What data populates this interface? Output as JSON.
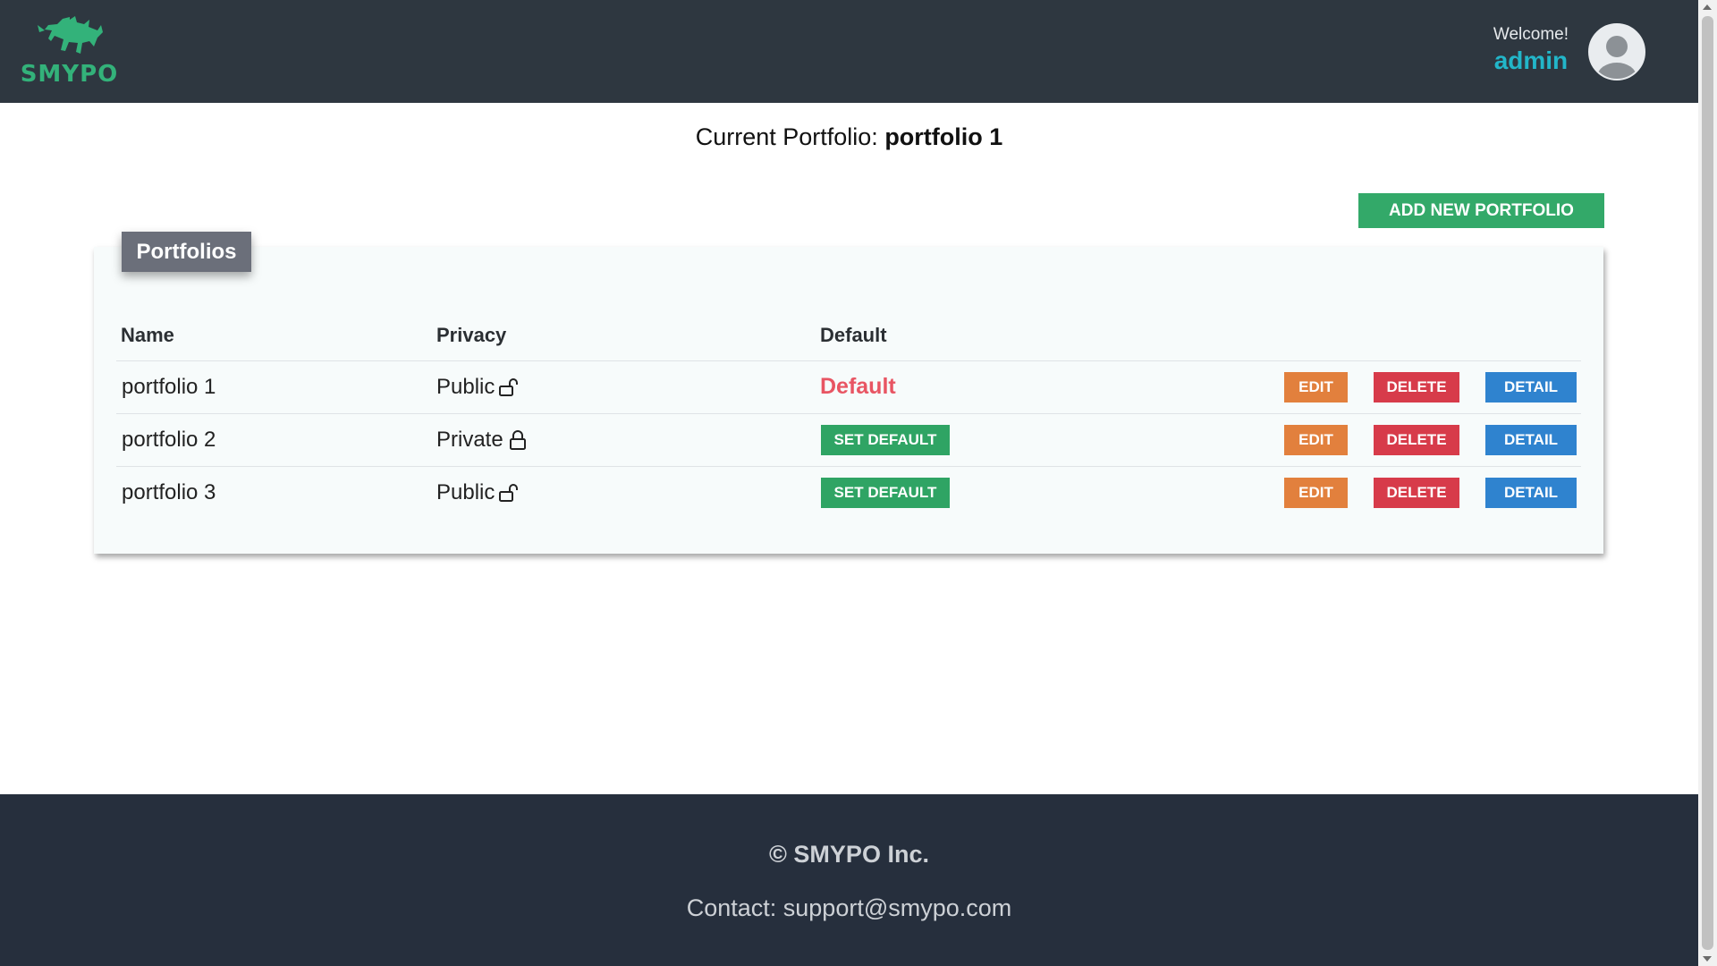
{
  "header": {
    "logo_text": "SMYPO",
    "welcome": "Welcome!",
    "username": "admin"
  },
  "current_portfolio": {
    "label": "Current Portfolio:",
    "name": "portfolio 1"
  },
  "add_button": "ADD NEW PORTFOLIO",
  "card_title": "Portfolios",
  "table": {
    "headers": [
      "Name",
      "Privacy",
      "Default"
    ],
    "rows": [
      {
        "name": "portfolio 1",
        "privacy": "Public",
        "privacy_icon": "unlock-icon",
        "default": "Default",
        "is_default": true
      },
      {
        "name": "portfolio 2",
        "privacy": "Private",
        "privacy_icon": "lock-icon",
        "default": "SET DEFAULT",
        "is_default": false
      },
      {
        "name": "portfolio 3",
        "privacy": "Public",
        "privacy_icon": "unlock-icon",
        "default": "SET DEFAULT",
        "is_default": false
      }
    ],
    "actions": {
      "edit": "EDIT",
      "delete": "DELETE",
      "detail": "DETAIL"
    }
  },
  "footer": {
    "copyright": "© SMYPO Inc.",
    "contact": "Contact: support@smypo.com"
  },
  "colors": {
    "header_bg": "#2e3740",
    "brand_green": "#33b27a",
    "accent_cyan": "#22b6c9",
    "add_green": "#33a969",
    "edit_orange": "#e2803d",
    "delete_red": "#d73b4a",
    "detail_blue": "#2f83cf",
    "default_red": "#e85563",
    "footer_bg": "#262f3d"
  }
}
